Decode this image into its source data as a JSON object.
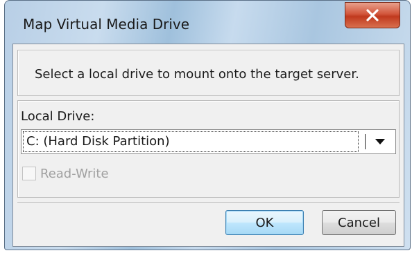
{
  "window": {
    "title": "Map Virtual Media Drive",
    "close_icon": "close-x-icon"
  },
  "instruction": "Select a local drive to mount onto the target server.",
  "local_drive": {
    "label": "Local Drive:",
    "selected_value": "C: (Hard Disk Partition)",
    "dropdown_icon": "chevron-down-icon"
  },
  "read_write": {
    "label": "Read-Write",
    "checked": false,
    "enabled": false
  },
  "buttons": {
    "ok_label": "OK",
    "cancel_label": "Cancel"
  },
  "colors": {
    "close_button": "#c8462a",
    "ok_border": "#3c7fb1",
    "disabled_text": "#a0a0a0"
  }
}
